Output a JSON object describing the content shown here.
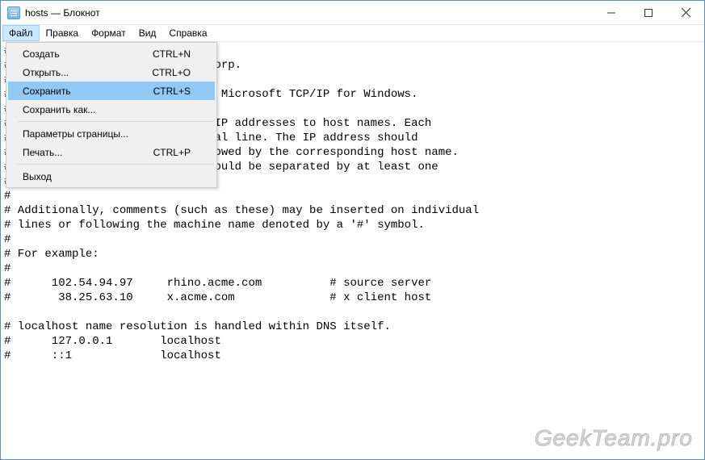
{
  "title": "hosts — Блокнот",
  "menubar": {
    "file": "Файл",
    "edit": "Правка",
    "format": "Формат",
    "view": "Вид",
    "help": "Справка"
  },
  "file_menu": {
    "new": {
      "label": "Создать",
      "shortcut": "CTRL+N"
    },
    "open": {
      "label": "Открыть...",
      "shortcut": "CTRL+O"
    },
    "save": {
      "label": "Сохранить",
      "shortcut": "CTRL+S"
    },
    "save_as": {
      "label": "Сохранить как...",
      "shortcut": ""
    },
    "page_setup": {
      "label": "Параметры страницы...",
      "shortcut": ""
    },
    "print": {
      "label": "Печать...",
      "shortcut": "CTRL+P"
    },
    "exit": {
      "label": "Выход",
      "shortcut": ""
    }
  },
  "editor_text": "#\n#                         oft Corp.\n#\n#                         ed by Microsoft TCP/IP for Windows.\n#\n#                         s of IP addresses to host names. Each\n#                         ividual line. The IP address should\n#                          followed by the corresponding host name.\n#                         me should be separated by at least one\n#\n#\n# Additionally, comments (such as these) may be inserted on individual\n# lines or following the machine name denoted by a '#' symbol.\n#\n# For example:\n#\n#      102.54.94.97     rhino.acme.com          # source server\n#       38.25.63.10     x.acme.com              # x client host\n\n# localhost name resolution is handled within DNS itself.\n#      127.0.0.1       localhost\n#      ::1             localhost",
  "watermark": "GeekTeam.pro"
}
